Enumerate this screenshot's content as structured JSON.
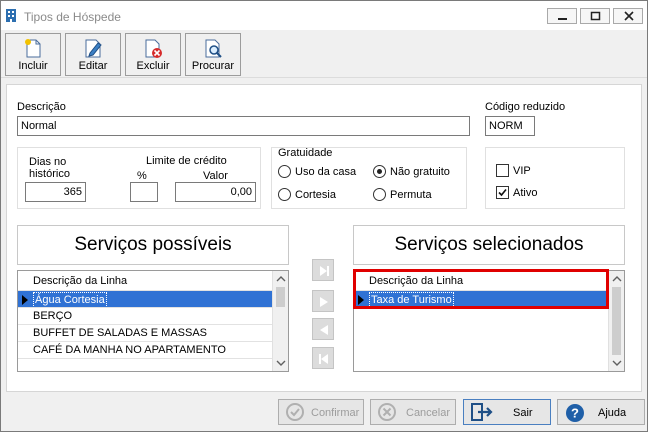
{
  "window": {
    "title": "Tipos de Hóspede",
    "controls": [
      "minimize",
      "restore",
      "close"
    ]
  },
  "toolbar": {
    "incluir": "Incluir",
    "editar": "Editar",
    "excluir": "Excluir",
    "procurar": "Procurar"
  },
  "form": {
    "descricao_label": "Descrição",
    "descricao_value": "Normal",
    "codigo_label": "Código reduzido",
    "codigo_value": "NORM",
    "dias_label_1": "Dias no",
    "dias_label_2": "histórico",
    "dias_value": "365",
    "limite_label": "Limite de crédito",
    "percent_label": "%",
    "percent_value": "",
    "valor_label": "Valor",
    "valor_value": "0,00",
    "gratuidade_label": "Gratuidade",
    "radio_uso_casa": "Uso da casa",
    "radio_nao_gratuito": "Não gratuito",
    "radio_cortesia": "Cortesia",
    "radio_permuta": "Permuta",
    "selected_radio": "Não gratuito",
    "vip_label": "VIP",
    "vip_checked": false,
    "ativo_label": "Ativo",
    "ativo_checked": true
  },
  "servicos_possiveis": {
    "title": "Serviços possíveis",
    "column": "Descrição da Linha",
    "rows": [
      "Água Cortesia",
      "BERÇO",
      "BUFFET DE SALADAS E MASSAS",
      "CAFÉ DA MANHA NO APARTAMENTO"
    ],
    "selected_index": 0
  },
  "servicos_selecionados": {
    "title": "Serviços selecionados",
    "column": "Descrição da Linha",
    "rows": [
      "Taxa de Turismo"
    ],
    "selected_index": 0
  },
  "footer": {
    "confirmar": "Confirmar",
    "cancelar": "Cancelar",
    "sair": "Sair",
    "ajuda": "Ajuda"
  },
  "colors": {
    "selection": "#3072d4",
    "highlight_border": "#e00000",
    "window_bg": "#f0f0f0"
  }
}
